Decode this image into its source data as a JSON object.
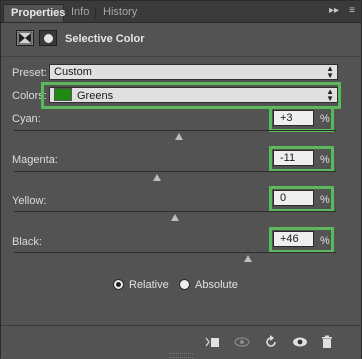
{
  "tabs": [
    {
      "label": "Properties",
      "active": true
    },
    {
      "label": "Info",
      "active": false
    },
    {
      "label": "History",
      "active": false
    }
  ],
  "panel_menu": {
    "collapse_icon": "double-chevron-right-icon",
    "menu_icon": "hamburger-icon"
  },
  "header": {
    "adjustment_icon": "selective-color-adjustment-icon",
    "mask_icon": "layer-mask-icon",
    "title": "Selective Color"
  },
  "preset": {
    "label": "Preset:",
    "value": "Custom"
  },
  "colors": {
    "label": "Colors:",
    "value": "Greens",
    "swatch_color": "#1f8a12"
  },
  "sliders": [
    {
      "label": "Cyan:",
      "value": "+3",
      "unit": "%"
    },
    {
      "label": "Magenta:",
      "value": "-11",
      "unit": "%"
    },
    {
      "label": "Yellow:",
      "value": "0",
      "unit": "%"
    },
    {
      "label": "Black:",
      "value": "+46",
      "unit": "%"
    }
  ],
  "method": {
    "options": [
      {
        "label": "Relative",
        "checked": true
      },
      {
        "label": "Absolute",
        "checked": false
      }
    ]
  },
  "highlight_color": "#5cb85c",
  "footer_icons": [
    "clip-to-layer-icon",
    "view-previous-state-icon",
    "reset-icon",
    "visibility-eye-icon",
    "trash-icon"
  ]
}
